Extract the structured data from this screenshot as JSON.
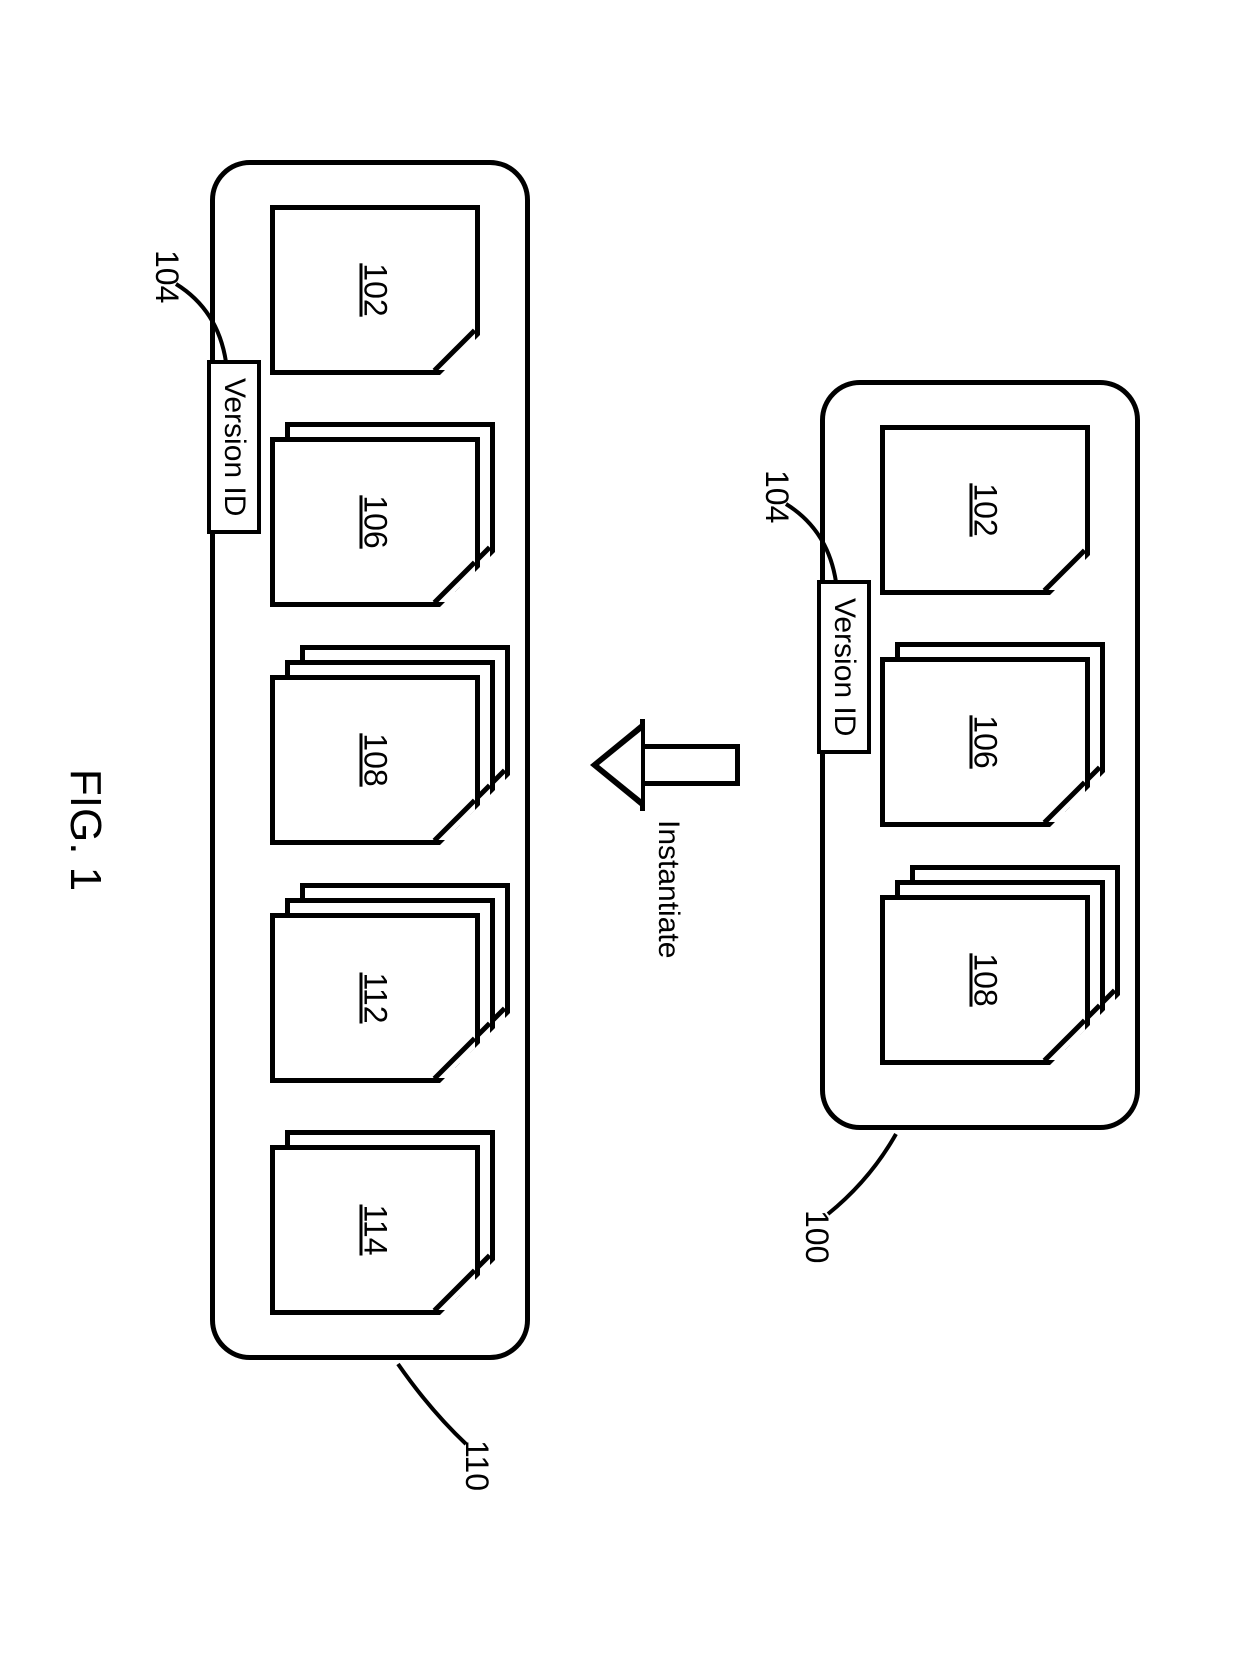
{
  "figure_label": "FIG. 1",
  "arrow_label": "Instantiate",
  "version_id_label": "Version ID",
  "top_container": {
    "ref": "100",
    "ref_104": "104",
    "docs": [
      {
        "label": "102",
        "copies": 1
      },
      {
        "label": "106",
        "copies": 2
      },
      {
        "label": "108",
        "copies": 3
      }
    ]
  },
  "bottom_container": {
    "ref": "110",
    "ref_104": "104",
    "docs": [
      {
        "label": "102",
        "copies": 1
      },
      {
        "label": "106",
        "copies": 2
      },
      {
        "label": "108",
        "copies": 3
      },
      {
        "label": "112",
        "copies": 3
      },
      {
        "label": "114",
        "copies": 2
      }
    ]
  }
}
